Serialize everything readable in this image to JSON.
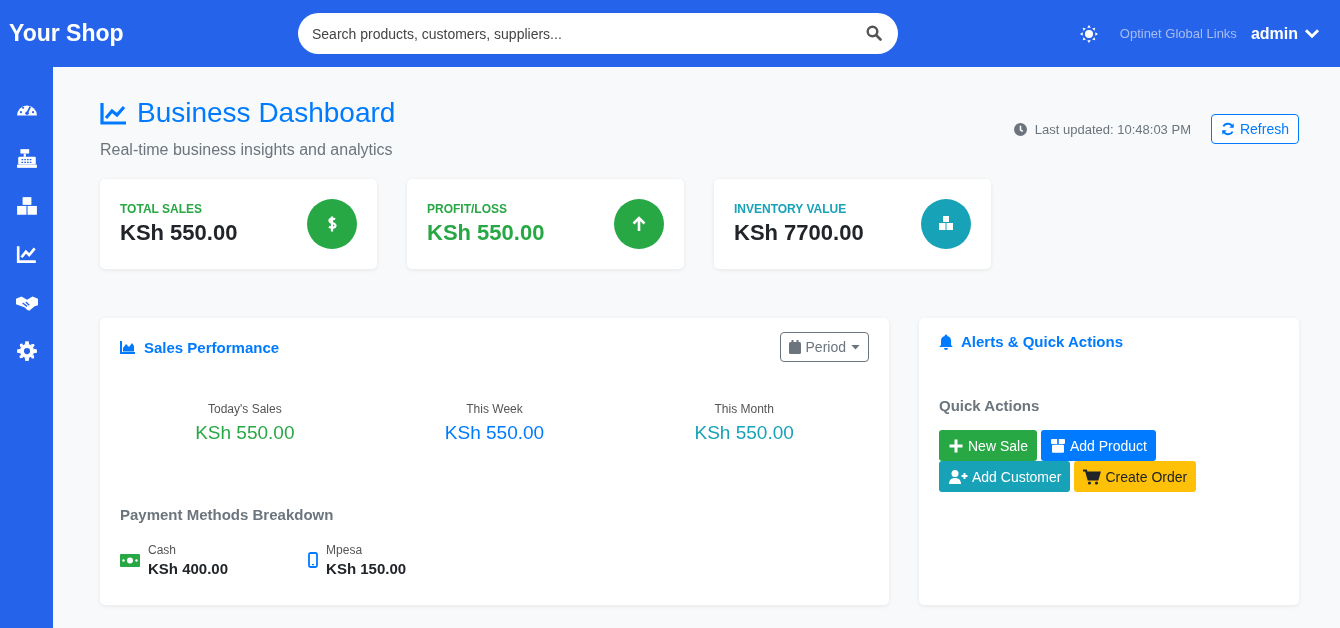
{
  "header": {
    "brand": "Your Shop",
    "search": {
      "placeholder": "Search products, customers, suppliers..."
    },
    "company": "Optinet Global Links",
    "user": "admin"
  },
  "page": {
    "title": "Business Dashboard",
    "subtitle": "Real-time business insights and analytics",
    "last_updated": "Last updated: 10:48:03 PM",
    "refresh": "Refresh"
  },
  "stats": [
    {
      "label": "TOTAL SALES",
      "value": "KSh 550.00",
      "kind": "dollar",
      "color": "#28a745",
      "value_colored": false
    },
    {
      "label": "PROFIT/LOSS",
      "value": "KSh 550.00",
      "kind": "arrow",
      "color": "#28a745",
      "value_colored": true
    },
    {
      "label": "INVENTORY VALUE",
      "value": "KSh 7700.00",
      "kind": "boxes",
      "color": "#17a2b8",
      "value_colored": false
    }
  ],
  "sales_performance": {
    "title": "Sales Performance",
    "period": "Period",
    "figures": [
      {
        "label": "Today's Sales",
        "value": "KSh 550.00",
        "color": "#28a745"
      },
      {
        "label": "This Week",
        "value": "KSh 550.00",
        "color": "#007bff"
      },
      {
        "label": "This Month",
        "value": "KSh 550.00",
        "color": "#17a2b8"
      }
    ],
    "payments_title": "Payment Methods Breakdown",
    "payments": [
      {
        "kind": "cash",
        "label": "Cash",
        "value": "KSh 400.00"
      },
      {
        "kind": "mobile",
        "label": "Mpesa",
        "value": "KSh 150.00"
      }
    ]
  },
  "alerts": {
    "title": "Alerts & Quick Actions",
    "quick_title": "Quick Actions",
    "actions": [
      {
        "kind": "plus",
        "label": "New Sale",
        "color": "#28a745"
      },
      {
        "kind": "box",
        "label": "Add Product",
        "color": "#007bff"
      },
      {
        "kind": "user",
        "label": "Add Customer",
        "color": "#17a2b8"
      },
      {
        "kind": "cart",
        "label": "Create Order",
        "color": "#ffc107"
      }
    ]
  }
}
